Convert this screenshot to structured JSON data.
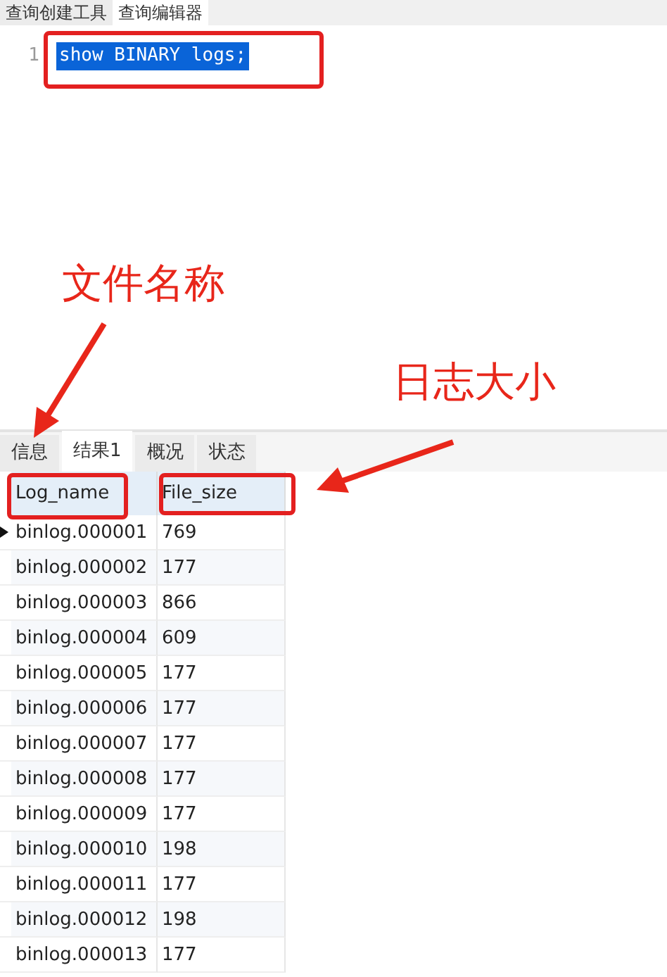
{
  "editor_tabs": [
    {
      "label": "查询创建工具",
      "selected": false
    },
    {
      "label": "查询编辑器",
      "selected": true
    }
  ],
  "editor": {
    "lines": [
      {
        "number": "1",
        "code": "show BINARY logs;",
        "selected": true
      }
    ]
  },
  "annotations": [
    {
      "text": "文件名称"
    },
    {
      "text": "日志大小"
    }
  ],
  "result_tabs": [
    {
      "label": "信息",
      "selected": false
    },
    {
      "label": "结果1",
      "selected": true
    },
    {
      "label": "概况",
      "selected": false
    },
    {
      "label": "状态",
      "selected": false
    }
  ],
  "table": {
    "columns": [
      "Log_name",
      "File_size"
    ],
    "rows": [
      {
        "cells": [
          "binlog.000001",
          "769"
        ],
        "current": true
      },
      {
        "cells": [
          "binlog.000002",
          "177"
        ],
        "current": false
      },
      {
        "cells": [
          "binlog.000003",
          "866"
        ],
        "current": false
      },
      {
        "cells": [
          "binlog.000004",
          "609"
        ],
        "current": false
      },
      {
        "cells": [
          "binlog.000005",
          "177"
        ],
        "current": false
      },
      {
        "cells": [
          "binlog.000006",
          "177"
        ],
        "current": false
      },
      {
        "cells": [
          "binlog.000007",
          "177"
        ],
        "current": false
      },
      {
        "cells": [
          "binlog.000008",
          "177"
        ],
        "current": false
      },
      {
        "cells": [
          "binlog.000009",
          "177"
        ],
        "current": false
      },
      {
        "cells": [
          "binlog.000010",
          "198"
        ],
        "current": false
      },
      {
        "cells": [
          "binlog.000011",
          "177"
        ],
        "current": false
      },
      {
        "cells": [
          "binlog.000012",
          "198"
        ],
        "current": false
      },
      {
        "cells": [
          "binlog.000013",
          "177"
        ],
        "current": false
      }
    ]
  }
}
